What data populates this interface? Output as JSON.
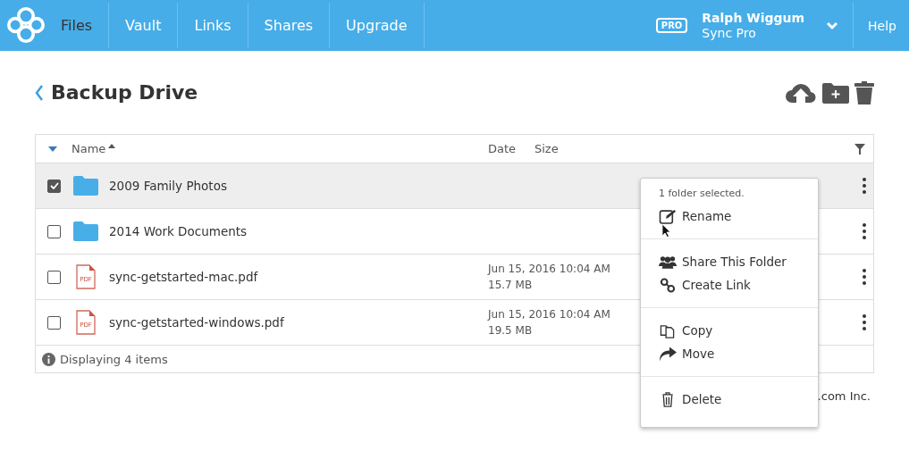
{
  "nav": {
    "tabs": [
      {
        "label": "Files",
        "selected": true
      },
      {
        "label": "Vault",
        "selected": false
      },
      {
        "label": "Links",
        "selected": false
      },
      {
        "label": "Shares",
        "selected": false
      },
      {
        "label": "Upgrade",
        "selected": false
      }
    ],
    "badge": "PRO",
    "user_name": "Ralph Wiggum",
    "plan": "Sync Pro",
    "help": "Help"
  },
  "title": "Backup Drive",
  "table": {
    "columns": [
      "Name",
      "Date",
      "Size"
    ],
    "rows": [
      {
        "kind": "folder",
        "name": "2009 Family Photos",
        "selected": true
      },
      {
        "kind": "folder",
        "name": "2014 Work Documents",
        "selected": false
      },
      {
        "kind": "pdf",
        "icon_text": "PDF",
        "name": "sync-getstarted-mac.pdf",
        "date": "Jun 15, 2016 10:04 AM",
        "size": "15.7 MB",
        "selected": false
      },
      {
        "kind": "pdf",
        "icon_text": "PDF",
        "name": "sync-getstarted-windows.pdf",
        "date": "Jun 15, 2016 10:04 AM",
        "size": "19.5 MB",
        "selected": false
      }
    ],
    "status": "Displaying 4 items"
  },
  "context_menu": {
    "heading": "1 folder selected.",
    "groups": [
      [
        {
          "kind": "rename",
          "label": "Rename"
        }
      ],
      [
        {
          "kind": "share",
          "label": "Share This Folder"
        },
        {
          "kind": "link",
          "label": "Create Link"
        }
      ],
      [
        {
          "kind": "copy",
          "label": "Copy"
        },
        {
          "kind": "move",
          "label": "Move"
        }
      ],
      [
        {
          "kind": "delete",
          "label": "Delete"
        }
      ]
    ]
  },
  "footer": ".com Inc."
}
